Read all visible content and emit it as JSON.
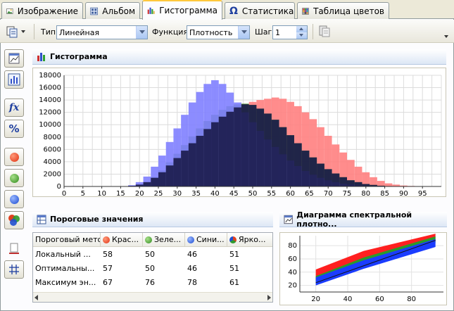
{
  "tabs": [
    {
      "label": "Изображение",
      "icon": "image-icon"
    },
    {
      "label": "Альбом",
      "icon": "album-icon"
    },
    {
      "label": "Гистограмма",
      "icon": "histogram-icon",
      "active": true
    },
    {
      "label": "Статистика",
      "icon": "omega-icon"
    },
    {
      "label": "Таблица цветов",
      "icon": "color-table-icon"
    }
  ],
  "toolbar": {
    "type_label": "Тип",
    "type_value": "Линейная",
    "function_label": "Функция",
    "function_value": "Плотность",
    "step_label": "Шаг",
    "step_value": "1"
  },
  "histogram_panel": {
    "title": "Гистограмма"
  },
  "threshold_panel": {
    "title": "Пороговые значения",
    "columns": [
      "Пороговый метод",
      "Крас...",
      "Зеле...",
      "Сини...",
      "Ярко..."
    ],
    "rows": [
      [
        "Локальный ...",
        "58",
        "50",
        "46",
        "51"
      ],
      [
        "Оптимальны...",
        "57",
        "50",
        "46",
        "51"
      ],
      [
        "Максимум эн...",
        "67",
        "76",
        "78",
        "61"
      ]
    ]
  },
  "spectral_panel": {
    "title": "Диаграмма спектральной плотно..."
  },
  "colors": {
    "red": "#ff8080",
    "green": "#4a8a2a",
    "blue": "#8080ff",
    "dark": "#191a4a",
    "accent": "#ffc83c"
  },
  "chart_data": [
    {
      "type": "bar",
      "title": "",
      "xlabel": "",
      "ylabel": "",
      "xlim": [
        0,
        100
      ],
      "ylim": [
        0,
        18000
      ],
      "x_ticks": [
        0,
        5,
        10,
        15,
        20,
        25,
        30,
        35,
        40,
        45,
        50,
        55,
        60,
        65,
        70,
        75,
        80,
        85,
        90,
        95
      ],
      "y_ticks": [
        0,
        2000,
        4000,
        6000,
        8000,
        10000,
        12000,
        14000,
        16000,
        18000
      ],
      "grid": true,
      "series": [
        {
          "color": "#ff8080",
          "x": [
            18,
            20,
            22,
            24,
            26,
            28,
            30,
            32,
            34,
            36,
            38,
            40,
            42,
            44,
            46,
            48,
            50,
            52,
            54,
            56,
            58,
            60,
            62,
            64,
            66,
            68,
            70,
            72,
            74,
            76,
            78,
            80,
            82,
            84,
            86,
            88,
            90,
            92,
            94,
            96
          ],
          "values": [
            100,
            300,
            700,
            1400,
            2300,
            3400,
            4600,
            5800,
            7000,
            8200,
            9300,
            10400,
            11300,
            12100,
            12800,
            13300,
            13700,
            14000,
            14200,
            14400,
            14200,
            13700,
            13000,
            12000,
            10900,
            9600,
            8200,
            6800,
            5500,
            4300,
            3200,
            2300,
            1500,
            900,
            500,
            300,
            150,
            80,
            40,
            20
          ]
        },
        {
          "color": "#4a8a2a",
          "x": [
            18,
            20,
            22,
            24,
            26,
            28,
            30,
            32,
            34,
            36,
            38,
            40,
            42,
            44,
            46,
            48,
            50,
            52,
            54,
            56,
            58,
            60,
            62,
            64,
            66,
            68,
            70,
            72,
            74,
            76,
            78,
            80,
            82,
            84,
            86,
            88,
            90,
            92,
            94,
            96
          ],
          "values": [
            100,
            300,
            700,
            1500,
            2600,
            3900,
            5300,
            6700,
            8100,
            9400,
            10600,
            11600,
            12400,
            13000,
            13300,
            13400,
            13200,
            12600,
            11800,
            10800,
            9600,
            8300,
            7000,
            5800,
            4700,
            3700,
            2800,
            2100,
            1500,
            1000,
            700,
            400,
            250,
            120,
            60,
            30,
            10,
            0,
            0,
            0
          ]
        },
        {
          "color": "#8080ff",
          "x": [
            18,
            20,
            22,
            24,
            26,
            28,
            30,
            32,
            34,
            36,
            38,
            40,
            42,
            44,
            46,
            48,
            50,
            52,
            54,
            56,
            58,
            60,
            62,
            64,
            66,
            68,
            70,
            72,
            74,
            76,
            78,
            80,
            82,
            84,
            86,
            88,
            90,
            92,
            94,
            96
          ],
          "values": [
            200,
            700,
            1600,
            3200,
            5000,
            7200,
            9400,
            11600,
            13600,
            15300,
            16600,
            17200,
            16600,
            15200,
            13600,
            12000,
            10400,
            9000,
            7600,
            6400,
            5200,
            4200,
            3300,
            2500,
            1900,
            1400,
            1000,
            700,
            450,
            300,
            180,
            100,
            60,
            30,
            10,
            0,
            0,
            0,
            0,
            0
          ]
        },
        {
          "color": "#191a4a",
          "x": [
            18,
            20,
            22,
            24,
            26,
            28,
            30,
            32,
            34,
            36,
            38,
            40,
            42,
            44,
            46,
            48,
            50,
            52,
            54,
            56,
            58,
            60,
            62,
            64,
            66,
            68,
            70,
            72,
            74,
            76,
            78,
            80,
            82,
            84,
            86,
            88,
            90,
            92,
            94,
            96
          ],
          "values": [
            100,
            300,
            700,
            1400,
            2300,
            3400,
            4600,
            5800,
            7000,
            8200,
            9300,
            10400,
            11300,
            12100,
            12800,
            13300,
            13200,
            12600,
            11800,
            10800,
            9600,
            8300,
            7000,
            5800,
            4700,
            3700,
            2800,
            2100,
            1500,
            1000,
            700,
            400,
            250,
            120,
            60,
            30,
            10,
            0,
            0,
            0
          ]
        }
      ]
    },
    {
      "type": "scatter",
      "title": "",
      "xlim": [
        10,
        100
      ],
      "ylim": [
        10,
        95
      ],
      "x_ticks": [
        20,
        40,
        60,
        80
      ],
      "y_ticks": [
        20,
        40,
        60,
        80
      ],
      "series": [
        {
          "color": "#ff2020",
          "band": [
            [
              20,
              28,
              44
            ],
            [
              50,
              55,
              72
            ],
            [
              95,
              86,
              98
            ]
          ]
        },
        {
          "color": "#2a9a2a",
          "band": [
            [
              20,
              25,
              34
            ],
            [
              50,
              52,
              62
            ],
            [
              95,
              84,
              94
            ]
          ]
        },
        {
          "color": "#1a3cff",
          "band": [
            [
              20,
              20,
              32
            ],
            [
              50,
              45,
              58
            ],
            [
              95,
              78,
              90
            ]
          ]
        }
      ],
      "trendline": [
        [
          20,
          24
        ],
        [
          95,
          88
        ]
      ]
    }
  ]
}
